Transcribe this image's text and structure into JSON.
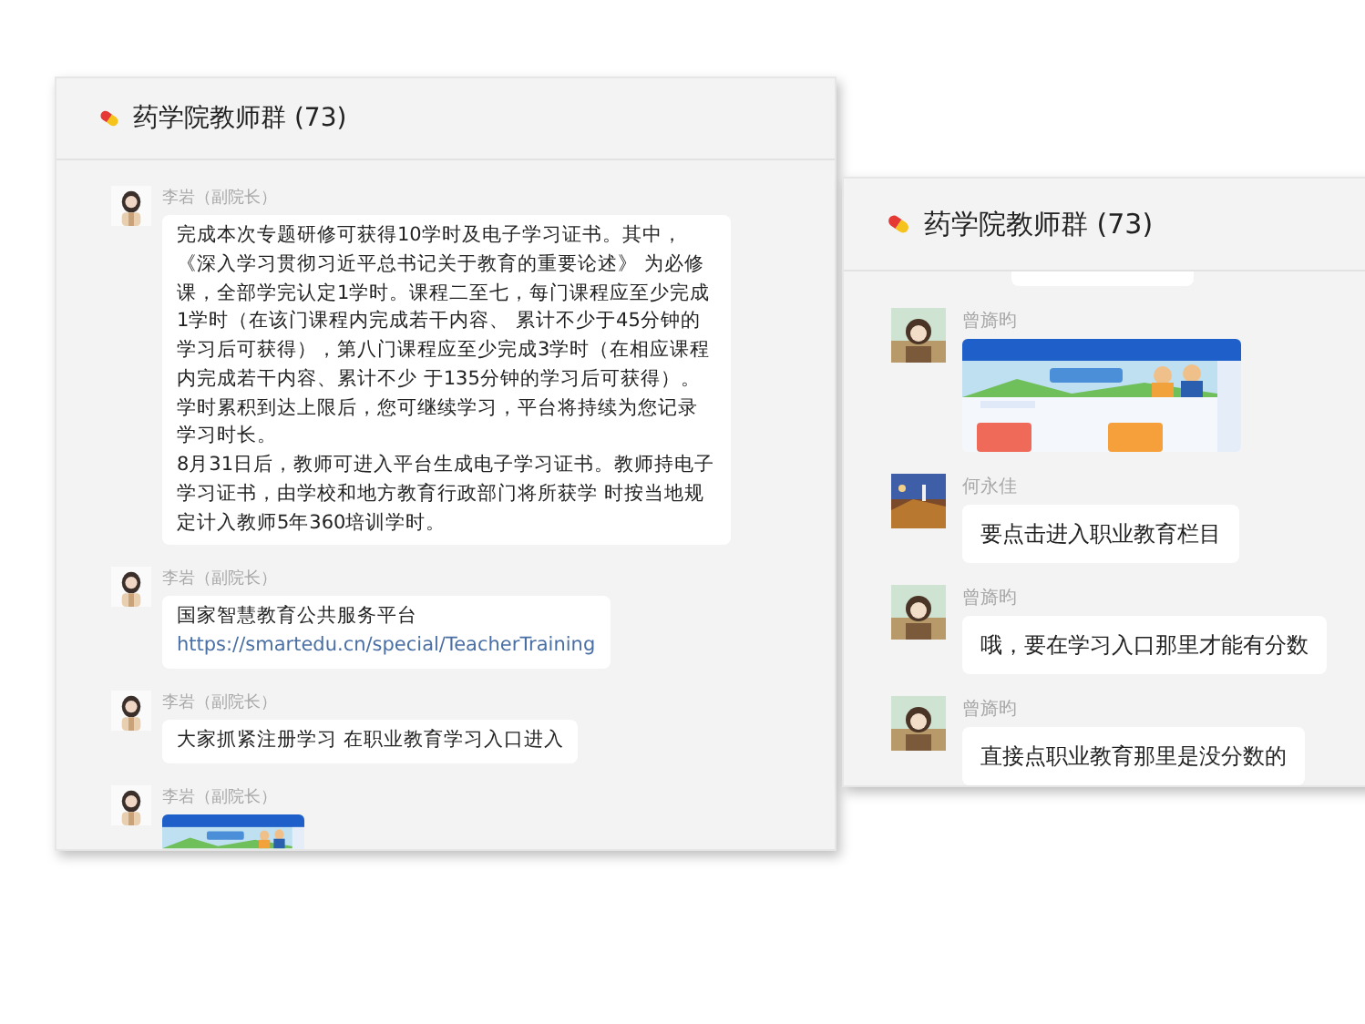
{
  "windows": [
    {
      "title": "药学院教师群",
      "count": "(73)",
      "messages": [
        {
          "kind": "text",
          "sender": "李岩（副院长）",
          "avatar": {
            "kind": "portrait"
          },
          "text": "完成本次专题研修可获得10学时及电子学习证书。其中，《深入学习贯彻习近平总书记关于教育的重要论述》 为必修课，全部学完认定1学时。课程二至七，每门课程应至少完成1学时（在该门课程内完成若干内容、 累计不少于45分钟的学习后可获得），第八门课程应至少完成3学时（在相应课程内完成若干内容、累计不少 于135分钟的学习后可获得）。学时累积到达上限后，您可继续学习，平台将持续为您记录学习时长。\n8月31日后，教师可进入平台生成电子学习证书。教师持电子学习证书，由学校和地方教育行政部门将所获学 时按当地规定计入教师5年360培训学时。"
        },
        {
          "kind": "link",
          "sender": "李岩（副院长）",
          "avatar": {
            "kind": "portrait"
          },
          "text": "国家智慧教育公共服务平台",
          "link": "https://smartedu.cn/special/TeacherTraining"
        },
        {
          "kind": "text",
          "sender": "李岩（副院长）",
          "avatar": {
            "kind": "portrait"
          },
          "text": "大家抓紧注册学习 在职业教育学习入口进入"
        },
        {
          "sender": "李岩（副院长）",
          "avatar": {
            "kind": "portrait"
          }
        }
      ]
    },
    {
      "title": "药学院教师群",
      "count": "(73)",
      "messages": [
        {
          "kind": "clipped"
        },
        {
          "sender": "曾旖昀"
        },
        {
          "kind": "text",
          "sender": "何永佳",
          "avatar": {
            "kind": "landscape"
          },
          "text": "要点击进入职业教育栏目"
        },
        {
          "kind": "text",
          "sender": "曾旖昀",
          "text": "哦，要在学习入口那里才能有分数"
        },
        {
          "kind": "text",
          "sender": "曾旖昀",
          "text": "直接点职业教育那里是没分数的"
        }
      ]
    }
  ]
}
